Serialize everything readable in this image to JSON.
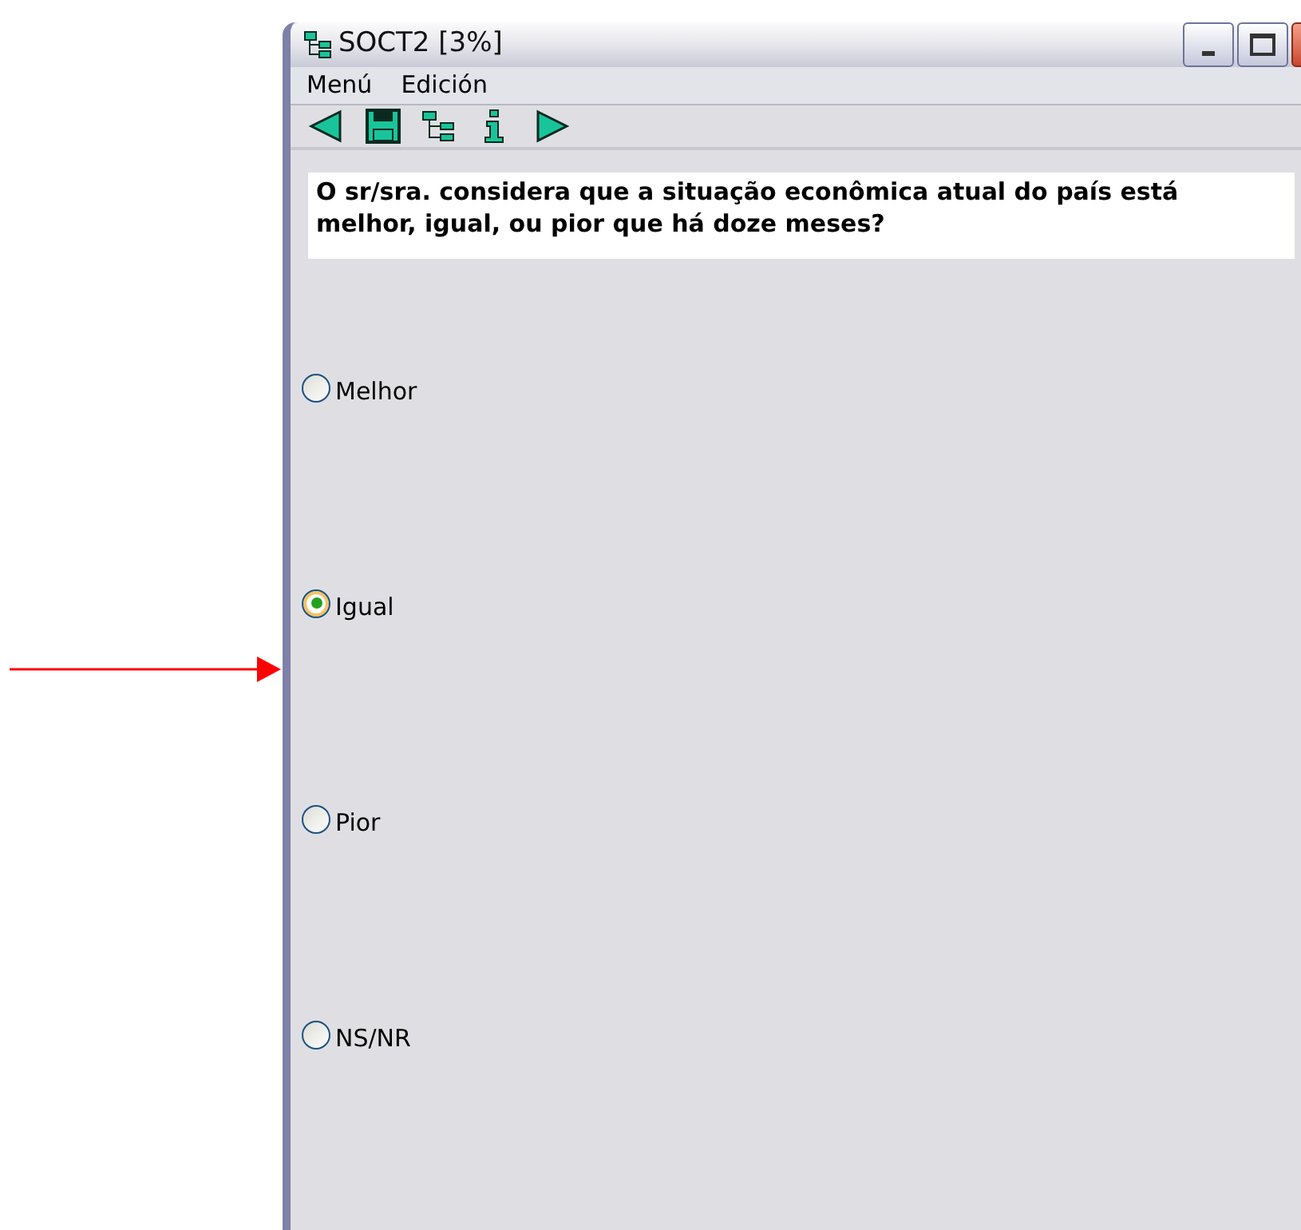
{
  "window": {
    "title": "SOCT2 [3%]"
  },
  "menu": [
    "Menú",
    "Edición"
  ],
  "toolbar": [
    {
      "kind": "back"
    },
    {
      "kind": "save"
    },
    {
      "kind": "tree"
    },
    {
      "kind": "info"
    },
    {
      "kind": "forward"
    }
  ],
  "question": "O sr/sra. considera que a situação econômica atual do país está melhor, igual, ou pior que há doze meses?",
  "options": [
    {
      "label": "Melhor",
      "selected": false
    },
    {
      "label": "Igual",
      "selected": true
    },
    {
      "label": "Pior",
      "selected": false
    },
    {
      "label": "NS/NR",
      "selected": false
    }
  ]
}
